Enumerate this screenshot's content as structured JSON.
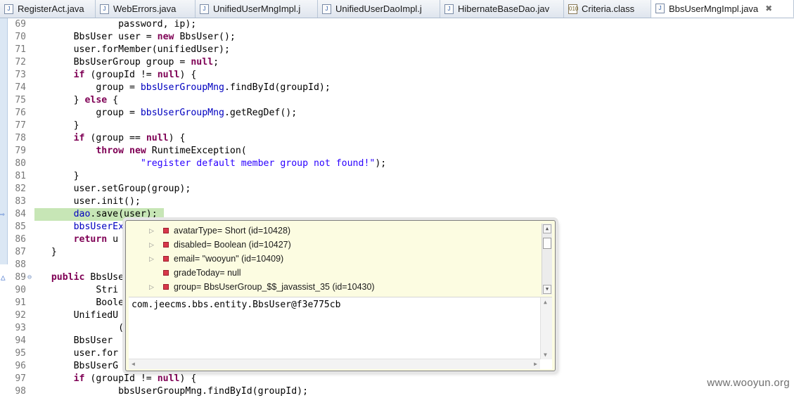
{
  "tabs": [
    {
      "label": "RegisterAct.java",
      "icon": "java-file-icon",
      "width": 136
    },
    {
      "label": "WebErrors.java",
      "icon": "java-file-icon",
      "width": 142
    },
    {
      "label": "UnifiedUserMngImpl.j",
      "icon": "java-file-icon",
      "width": 174
    },
    {
      "label": "UnifiedUserDaoImpl.j",
      "icon": "java-file-icon",
      "width": 174
    },
    {
      "label": "HibernateBaseDao.jav",
      "icon": "java-file-icon",
      "width": 176
    },
    {
      "label": "Criteria.class",
      "icon": "class-file-icon",
      "width": 124
    },
    {
      "label": "BbsUserMngImpl.java",
      "icon": "java-file-icon",
      "active": true,
      "close": "✖"
    }
  ],
  "lines": [
    {
      "n": "69",
      "html": "            password, ip);"
    },
    {
      "n": "70",
      "html": "    BbsUser user = <k>new</k> BbsUser();"
    },
    {
      "n": "71",
      "html": "    user.forMember(unifiedUser);"
    },
    {
      "n": "72",
      "html": "    BbsUserGroup group = <k>null</k>;"
    },
    {
      "n": "73",
      "html": "    <k>if</k> (groupId != <k>null</k>) {"
    },
    {
      "n": "74",
      "html": "        group = <f>bbsUserGroupMng</f>.findById(groupId);"
    },
    {
      "n": "75",
      "html": "    } <k>else</k> {"
    },
    {
      "n": "76",
      "html": "        group = <f>bbsUserGroupMng</f>.getRegDef();"
    },
    {
      "n": "77",
      "html": "    }"
    },
    {
      "n": "78",
      "html": "    <k>if</k> (group == <k>null</k>) {"
    },
    {
      "n": "79",
      "html": "        <k>throw</k> <k>new</k> RuntimeException("
    },
    {
      "n": "80",
      "html": "                <s>\"register default member group not found!\"</s>);"
    },
    {
      "n": "81",
      "html": "    }"
    },
    {
      "n": "82",
      "html": "    user.setGroup(group);"
    },
    {
      "n": "83",
      "html": "    user.init();"
    },
    {
      "n": "84",
      "html": "    <f>dao</f>.save(user);",
      "current": true
    },
    {
      "n": "85",
      "html": "    <f>bbsUserEx</f>"
    },
    {
      "n": "86",
      "html": "    <k>return</k> u"
    },
    {
      "n": "87",
      "html": "}"
    },
    {
      "n": "88",
      "html": ""
    },
    {
      "n": "89",
      "html": "<k>public</k> BbsUse",
      "fold": true,
      "override": true
    },
    {
      "n": "90",
      "html": "        Stri"
    },
    {
      "n": "91",
      "html": "        Boole"
    },
    {
      "n": "92",
      "html": "    UnifiedU"
    },
    {
      "n": "93",
      "html": "            ("
    },
    {
      "n": "94",
      "html": "    BbsUser "
    },
    {
      "n": "95",
      "html": "    user.for"
    },
    {
      "n": "96",
      "html": "    BbsUserG"
    },
    {
      "n": "97",
      "html": "    <k>if</k> (groupId != <k>null</k>) {"
    },
    {
      "n": "98",
      "html": "            bbsUserGroupMng.findById(groupId);"
    }
  ],
  "popup": {
    "variables": [
      {
        "text": "avatarType= Short  (id=10428)",
        "expandable": true
      },
      {
        "text": "disabled= Boolean  (id=10427)",
        "expandable": true
      },
      {
        "text": "email= \"wooyun\" (id=10409)",
        "expandable": true
      },
      {
        "text": "gradeToday= null",
        "expandable": false
      },
      {
        "text": "group= BbsUserGroup_$$_javassist_35  (id=10430)",
        "expandable": true
      }
    ],
    "detail": "com.jeecms.bbs.entity.BbsUser@f3e775cb"
  },
  "watermark": "www.wooyun.org",
  "colors": {
    "keyword": "#7f0055",
    "string": "#2a00ff",
    "field": "#0000c0",
    "current_line": "#c7e6b6",
    "popup_bg": "#fcfce1"
  }
}
